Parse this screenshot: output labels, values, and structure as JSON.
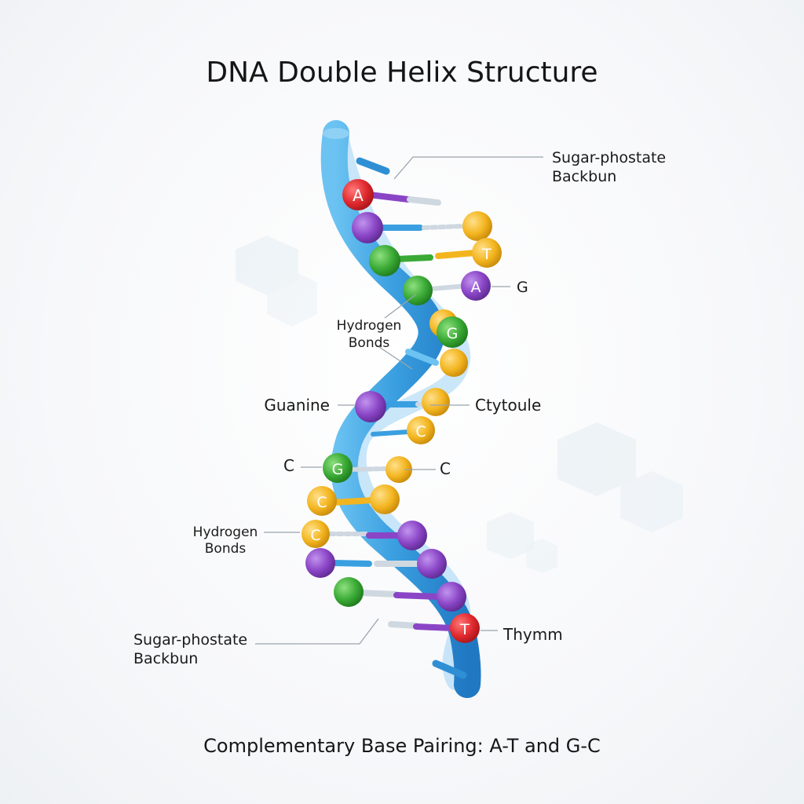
{
  "title": "DNA Double Helix Structure",
  "caption": "Complementary Base Pairing: A-T and G-C",
  "colors": {
    "backbone": "#3a9fe0",
    "adenine_red": "#e02a2f",
    "purple": "#8a45c6",
    "green": "#3aaa35",
    "yellow": "#f3b51f"
  },
  "labels": {
    "backbone_top_line1": "Sugar-phostate",
    "backbone_top_line2": "Backbun",
    "g_right": "G",
    "hydrogen_top_line1": "Hydrogen",
    "hydrogen_top_line2": "Bonds",
    "guanine": "Guanine",
    "cytoule": "Ctytoule",
    "c_left": "C",
    "c_right": "C",
    "hydrogen_bottom_line1": "Hydrogen",
    "hydrogen_bottom_line2": "Bonds",
    "backbone_bottom_line1": "Sugar-phostate",
    "backbone_bottom_line2": "Backbun",
    "thymm": "Thymm"
  },
  "base_letters": {
    "a_top": "A",
    "t_top": "T",
    "a_mid": "A",
    "g_mid": "G",
    "c_mid": "C",
    "g_low": "G",
    "c_low1": "C",
    "c_low2": "C",
    "t_bottom": "T"
  }
}
